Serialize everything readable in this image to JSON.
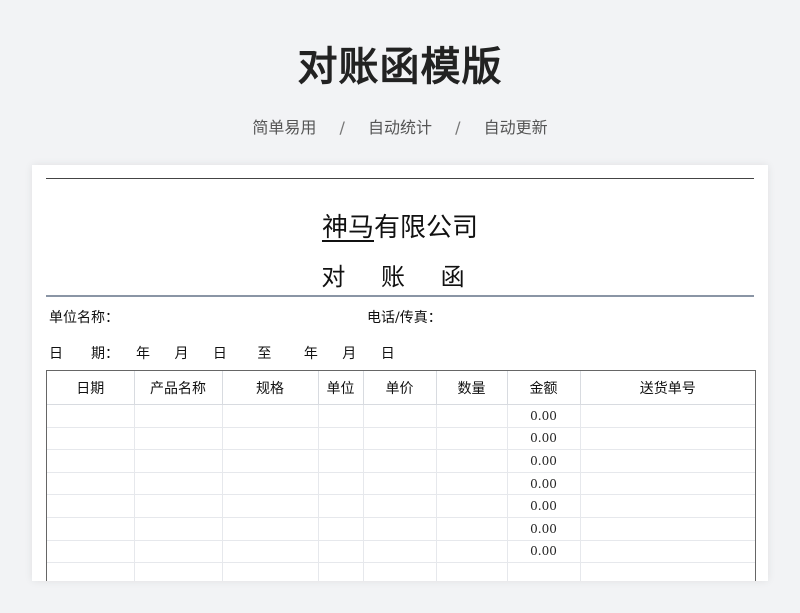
{
  "header": {
    "title": "对账函模版",
    "features": [
      "简单易用",
      "自动统计",
      "自动更新"
    ],
    "separator": "/"
  },
  "document": {
    "company_underlined": "神马",
    "company_rest": "有限公司",
    "title": "对 账 函",
    "unit_name_label": "单位名称：",
    "phone_fax_label": "电话/传真：",
    "date_label": "日　　期：",
    "date_parts": [
      "年",
      "月",
      "日",
      "至",
      "年",
      "月",
      "日"
    ]
  },
  "table": {
    "columns": [
      "日期",
      "产品名称",
      "规格",
      "单位",
      "单价",
      "数量",
      "金额",
      "送货单号"
    ],
    "rows": [
      [
        "",
        "",
        "",
        "",
        "",
        "",
        "0.00",
        ""
      ],
      [
        "",
        "",
        "",
        "",
        "",
        "",
        "0.00",
        ""
      ],
      [
        "",
        "",
        "",
        "",
        "",
        "",
        "0.00",
        ""
      ],
      [
        "",
        "",
        "",
        "",
        "",
        "",
        "0.00",
        ""
      ],
      [
        "",
        "",
        "",
        "",
        "",
        "",
        "0.00",
        ""
      ],
      [
        "",
        "",
        "",
        "",
        "",
        "",
        "0.00",
        ""
      ],
      [
        "",
        "",
        "",
        "",
        "",
        "",
        "0.00",
        ""
      ],
      [
        "",
        "",
        "",
        "",
        "",
        "",
        "",
        ""
      ]
    ]
  }
}
